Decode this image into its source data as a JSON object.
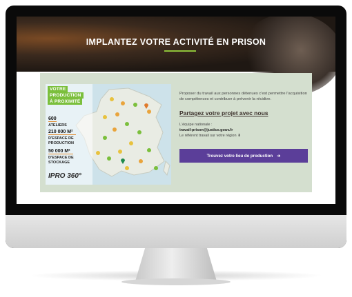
{
  "hero": {
    "title": "IMPLANTEZ VOTRE ACTIVITÉ EN PRISON"
  },
  "map_panel": {
    "badge_lines": [
      "VOTRE",
      "PRODUCTION",
      "À PROXIMITÉ"
    ],
    "stats": [
      {
        "value": "600",
        "label": "ATELIERS"
      },
      {
        "value": "210 000 M²",
        "label": "D'ESPACE DE PRODUCTION"
      },
      {
        "value": "50 000 M²",
        "label": "D'ESPACE DE STOCKAGE"
      }
    ],
    "logo": "IPRO 360°"
  },
  "info": {
    "description": "Proposer du travail aux personnes détenues c'est permettre l'acquisition de compétences et contribuer à prévenir la récidive.",
    "share_heading": "Partagez votre projet avec nous",
    "team_label": "L'équipe nationale :",
    "team_email": "travail-prison@justice.gouv.fr",
    "regional_ref": "Le référent travail sur votre région",
    "cta_label": "Trouvez votre lieu de production",
    "cta_icon": "arrow-right-icon"
  },
  "colors": {
    "accent": "#5b3e99",
    "green": "#7bbf3c",
    "card": "#d4dfcf"
  }
}
